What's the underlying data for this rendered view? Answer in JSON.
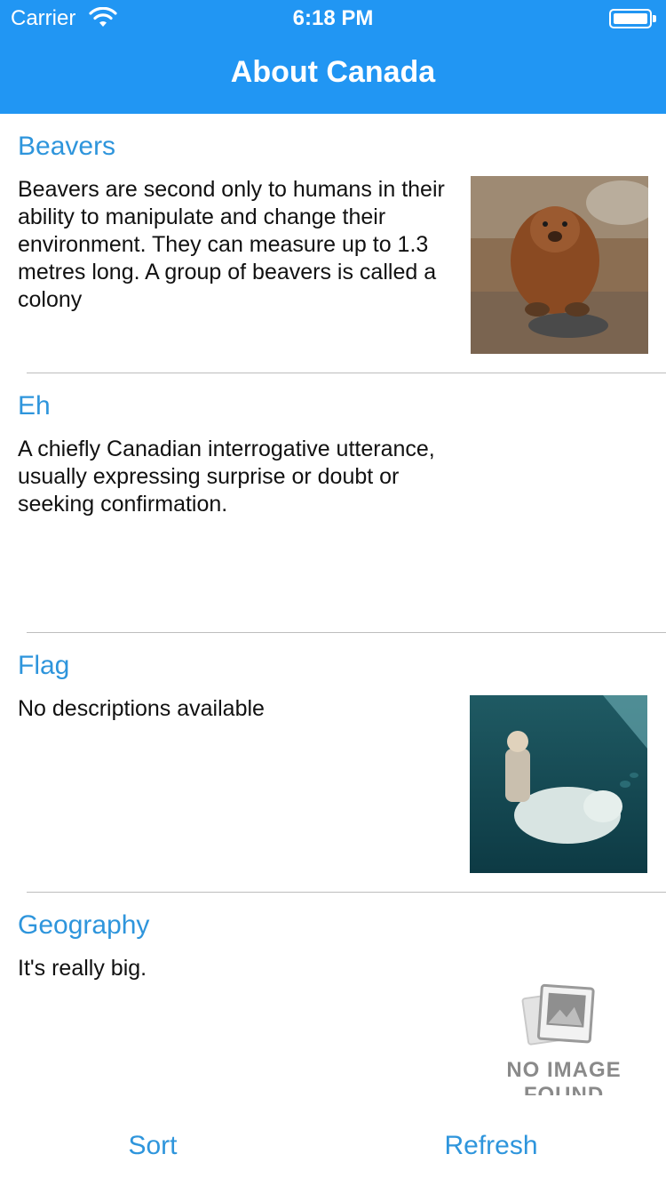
{
  "status_bar": {
    "carrier": "Carrier",
    "time": "6:18 PM"
  },
  "nav": {
    "title": "About Canada"
  },
  "rows": [
    {
      "title": "Beavers",
      "description": "Beavers are second only to humans in their ability to manipulate and change their environment. They can measure up to 1.3 metres long. A group of beavers is called a colony",
      "image": "beaver-photo"
    },
    {
      "title": "Eh",
      "description": "A chiefly Canadian interrogative utterance, usually expressing surprise or doubt or seeking confirmation.",
      "image": ""
    },
    {
      "title": "Flag",
      "description": "No descriptions available",
      "image": "polar-bear-rider-photo"
    },
    {
      "title": "Geography",
      "description": "It's really big.",
      "image": "no-image-placeholder",
      "placeholder_text": "NO IMAGE FOUND"
    }
  ],
  "toolbar": {
    "sort_label": "Sort",
    "refresh_label": "Refresh"
  },
  "colors": {
    "accent": "#2196F3",
    "link": "#2E95DC"
  }
}
